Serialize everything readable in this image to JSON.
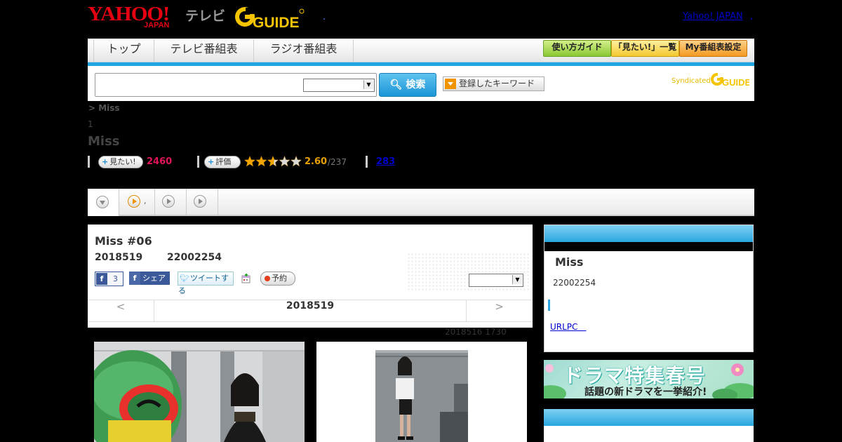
{
  "header": {
    "yahoo_logo_main": "YAHOO!",
    "yahoo_logo_sub": "JAPAN",
    "tv_label": "テレビ",
    "gguide_logo": "GUIDE",
    "yahoo_japan_link": "Yahoo! JAPAN",
    "yahoo_japan_comma": ","
  },
  "nav": {
    "tabs": [
      {
        "label": "トップ"
      },
      {
        "label": "テレビ番組表"
      },
      {
        "label": "ラジオ番組表"
      }
    ],
    "guide_btn": "使い方ガイド",
    "mitai_list_btn": "「見たい!」一覧",
    "my_settings_btn": "My番組表設定"
  },
  "search": {
    "input_value": "",
    "select_value": "",
    "button_label": "検索",
    "keyword_button": "登録したキーワード",
    "syndicated": "Syndicated"
  },
  "program": {
    "breadcrumb": "> Miss",
    "number": "1",
    "title": "Miss",
    "mitai_label": "見たい!",
    "mitai_count": "2460",
    "rating_label": "評価",
    "rating": "2.60",
    "rating_total": "/237",
    "review_count": "283",
    "stars": 2.6
  },
  "tabs": {
    "tab2_suffix": ","
  },
  "episode": {
    "title": "Miss #06",
    "date": "2018519",
    "time": "22002254",
    "fb_like_count": "3",
    "fb_share": "シェア",
    "tweet": "ツイートする",
    "reserve": "予約",
    "select_value": "",
    "prev": "<",
    "current": "2018519",
    "next": ">",
    "updated": "2018516  1730"
  },
  "sidebar": {
    "title": "Miss",
    "time": "22002254",
    "link": "URLPC　",
    "banner_line1": "ドラマ特集春号",
    "banner_line2": "話題の新ドラマを一挙紹介!"
  },
  "colors": {
    "accent_blue": "#1fa6e0",
    "mitai_pink": "#e0145a",
    "rating_orange": "#e8a000",
    "yahoo_red": "#e60012"
  }
}
